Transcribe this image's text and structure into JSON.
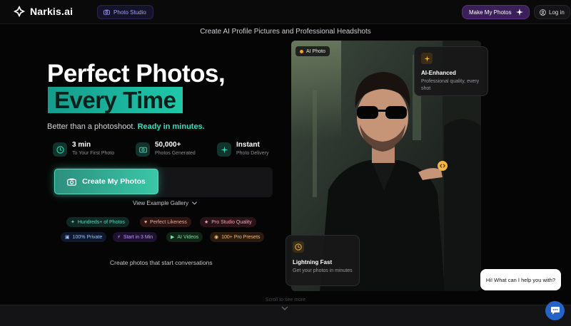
{
  "header": {
    "logo_text": "Narkis.ai",
    "studio_label": "Photo Studio",
    "make_photos_label": "Make My Photos",
    "login_label": "Log in"
  },
  "tagline": "Create AI Profile Pictures and Professional Headshots",
  "hero": {
    "title_line1": "Perfect Photos,",
    "title_line2": "Every Time",
    "subtitle_plain": "Better than a photoshoot.",
    "subtitle_bold": "Ready in minutes."
  },
  "stats": [
    {
      "value": "3 min",
      "label": "To Your First Photo",
      "icon": "clock-icon"
    },
    {
      "value": "50,000+",
      "label": "Photos Generated",
      "icon": "camera-icon"
    },
    {
      "value": "Instant",
      "label": "Photo Delivery",
      "icon": "sparkle-icon"
    }
  ],
  "cta": {
    "primary_label": "Create My Photos",
    "gallery_label": "View Example Gallery"
  },
  "tags": [
    {
      "label": "Hundreds+ of Photos",
      "icon": "sparkle-icon",
      "color": "#5fd3b5",
      "bg": "#0f2a25"
    },
    {
      "label": "Perfect Likeness",
      "icon": "heart-icon",
      "color": "#f2a890",
      "bg": "#2d1512"
    },
    {
      "label": "Pro Studio Quality",
      "icon": "star-icon",
      "color": "#f0a4b4",
      "bg": "#2a1219"
    },
    {
      "label": "100% Private",
      "icon": "lock-icon",
      "color": "#9fc2f5",
      "bg": "#10192c"
    },
    {
      "label": "Start in 3 Min",
      "icon": "bolt-icon",
      "color": "#c49cf5",
      "bg": "#1e1230"
    },
    {
      "label": "AI Videos",
      "icon": "video-icon",
      "color": "#7fe0a8",
      "bg": "#102616"
    },
    {
      "label": "100+ Pro Presets",
      "icon": "palette-icon",
      "color": "#f0be83",
      "bg": "#2a1b0c"
    }
  ],
  "conversations": "Create photos that start conversations",
  "photo": {
    "badge": "AI Photo",
    "card_top": {
      "title": "AI-Enhanced",
      "desc": "Professional quality, every shot"
    },
    "card_bottom": {
      "title": "Lightning Fast",
      "desc": "Get your photos in minutes"
    }
  },
  "scroll_hint": "Scroll to see more",
  "chat": {
    "message": "Hi! What can I help you with?"
  }
}
